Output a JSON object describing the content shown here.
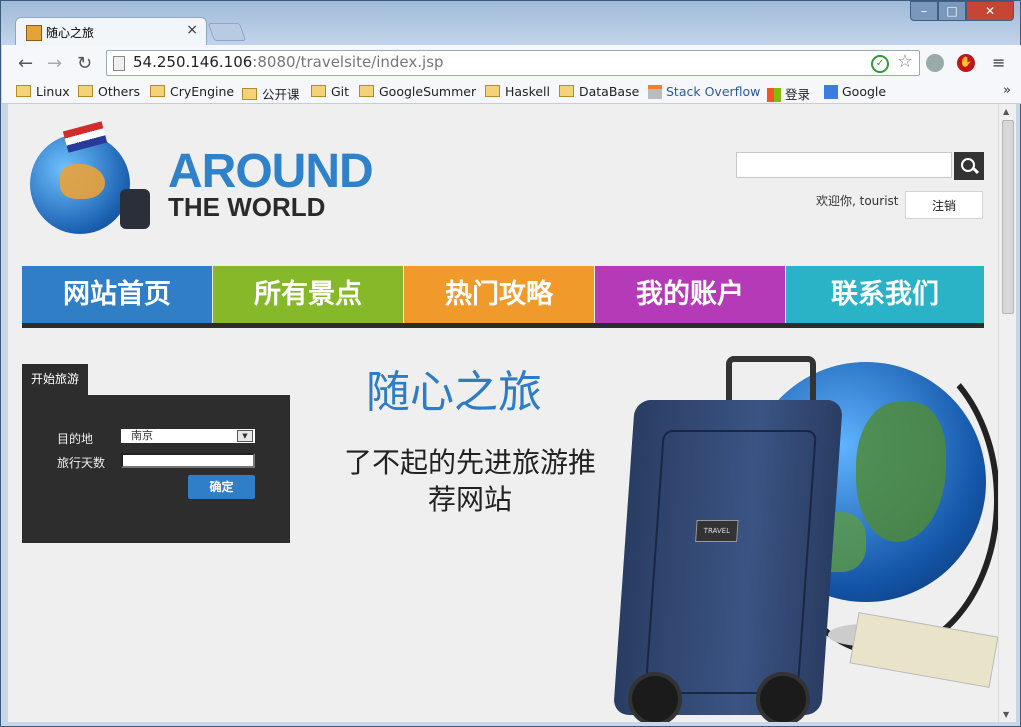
{
  "browser": {
    "tab_title": "随心之旅",
    "tab_close": "×",
    "url_host": "54.250.146.106",
    "url_rest": ":8080/travelsite/index.jsp",
    "back_glyph": "←",
    "forward_glyph": "→",
    "reload_glyph": "↻",
    "menu_glyph": "≡",
    "star_glyph": "☆",
    "min_glyph": "–",
    "max_glyph": "□",
    "close_glyph": "✕",
    "more_glyph": "»"
  },
  "bookmarks": [
    {
      "label": "Linux",
      "icon": "folder-icon"
    },
    {
      "label": "Others",
      "icon": "folder-icon"
    },
    {
      "label": "CryEngine",
      "icon": "folder-icon"
    },
    {
      "label": "公开课",
      "icon": "folder-icon"
    },
    {
      "label": "Git",
      "icon": "folder-icon"
    },
    {
      "label": "GoogleSummer",
      "icon": "folder-icon"
    },
    {
      "label": "Haskell",
      "icon": "folder-icon"
    },
    {
      "label": "DataBase",
      "icon": "folder-icon"
    },
    {
      "label": "Stack Overflow",
      "icon": "stackoverflow-icon"
    },
    {
      "label": "登录",
      "icon": "windows-icon"
    },
    {
      "label": "Google",
      "icon": "google-icon"
    }
  ],
  "site": {
    "logo_line1": "AROUND",
    "logo_line2": "THE WORLD",
    "welcome": "欢迎你, tourist",
    "logout": "注销",
    "nav": [
      {
        "label": "网站首页",
        "color": "#2f7ec6"
      },
      {
        "label": "所有景点",
        "color": "#86b92a"
      },
      {
        "label": "热门攻略",
        "color": "#ef9a2a"
      },
      {
        "label": "我的账户",
        "color": "#b43ab8"
      },
      {
        "label": "联系我们",
        "color": "#2ab3c6"
      }
    ],
    "trip_tab": "开始旅游",
    "dest_label": "目的地",
    "dest_value": "南京",
    "days_label": "旅行天数",
    "confirm": "确定",
    "hero_title": "随心之旅",
    "hero_sub": "了不起的先进旅游推荐网站",
    "suitcase_tag": "TRAVEL"
  }
}
